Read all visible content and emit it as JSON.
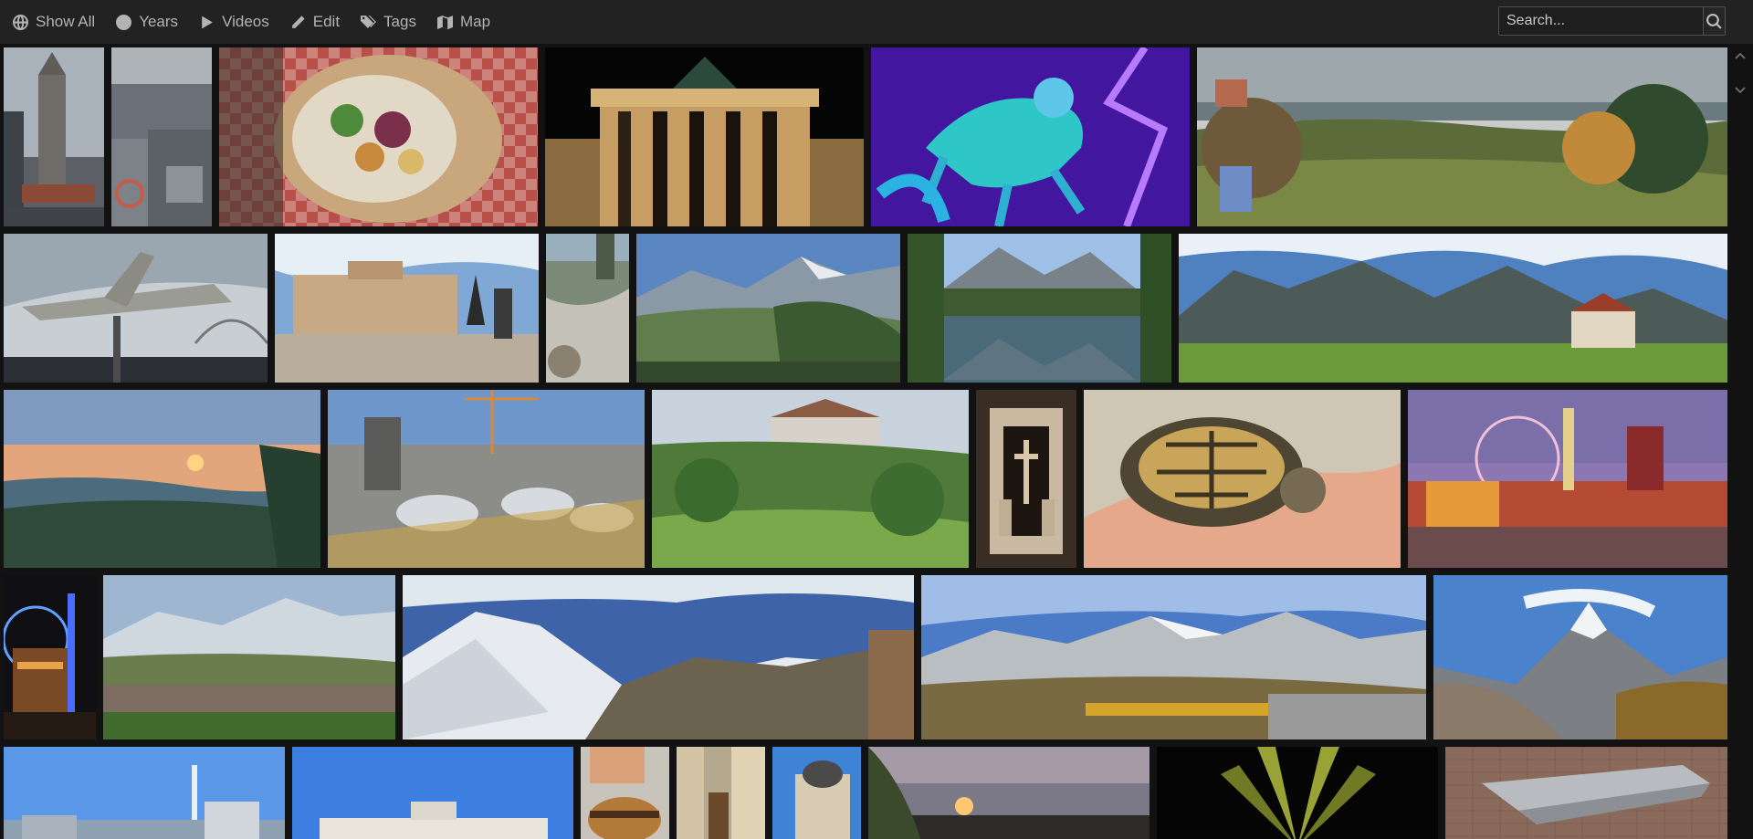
{
  "nav": {
    "items": [
      {
        "label": "Show All",
        "icon": "globe-icon"
      },
      {
        "label": "Years",
        "icon": "clock-icon"
      },
      {
        "label": "Videos",
        "icon": "play-icon"
      },
      {
        "label": "Edit",
        "icon": "pencil-icon"
      },
      {
        "label": "Tags",
        "icon": "tags-icon"
      },
      {
        "label": "Map",
        "icon": "map-icon"
      }
    ]
  },
  "search": {
    "placeholder": "Search...",
    "value": "",
    "button_icon": "search-icon"
  },
  "scroll": {
    "up_icon": "chevron-up-icon",
    "down_icon": "chevron-down-icon"
  },
  "colors": {
    "topbar": "#222222",
    "background": "#121212",
    "nav_text": "#b3b3b3"
  },
  "photos": [
    {
      "subject": "church-tower"
    },
    {
      "subject": "city-aerial"
    },
    {
      "subject": "food-plate"
    },
    {
      "subject": "brandenburg-gate-night"
    },
    {
      "subject": "neon-unicorn"
    },
    {
      "subject": "mountain-overlook"
    },
    {
      "subject": "airplane-monument"
    },
    {
      "subject": "opera-house-square"
    },
    {
      "subject": "stream-small"
    },
    {
      "subject": "alpine-valley"
    },
    {
      "subject": "mountain-lake"
    },
    {
      "subject": "alpine-meadow-panorama"
    },
    {
      "subject": "sunset-hills"
    },
    {
      "subject": "construction-site"
    },
    {
      "subject": "castle-green-hills"
    },
    {
      "subject": "altar-carving"
    },
    {
      "subject": "tortoise-in-hand"
    },
    {
      "subject": "christmas-market"
    },
    {
      "subject": "ferris-wheel-night"
    },
    {
      "subject": "valley-town"
    },
    {
      "subject": "snowy-summit-panorama"
    },
    {
      "subject": "mountain-range-panorama"
    },
    {
      "subject": "aiguille-peak"
    },
    {
      "subject": "fountain-lake"
    },
    {
      "subject": "palace-blue-sky"
    },
    {
      "subject": "burger"
    },
    {
      "subject": "ornate-street"
    },
    {
      "subject": "domed-building"
    },
    {
      "subject": "sunset-trees"
    },
    {
      "subject": "light-show"
    },
    {
      "subject": "stone-wall-sculpture"
    }
  ]
}
